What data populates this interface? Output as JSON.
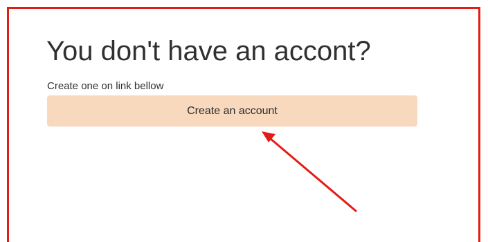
{
  "prompt": {
    "heading": "You don't have an accont?",
    "subtext": "Create one on link bellow",
    "button_label": "Create an account"
  },
  "annotation": {
    "frame_color": "#e41b17",
    "arrow_color": "#e41b17"
  },
  "colors": {
    "button_bg": "#f8d9bd",
    "text": "#303030"
  }
}
